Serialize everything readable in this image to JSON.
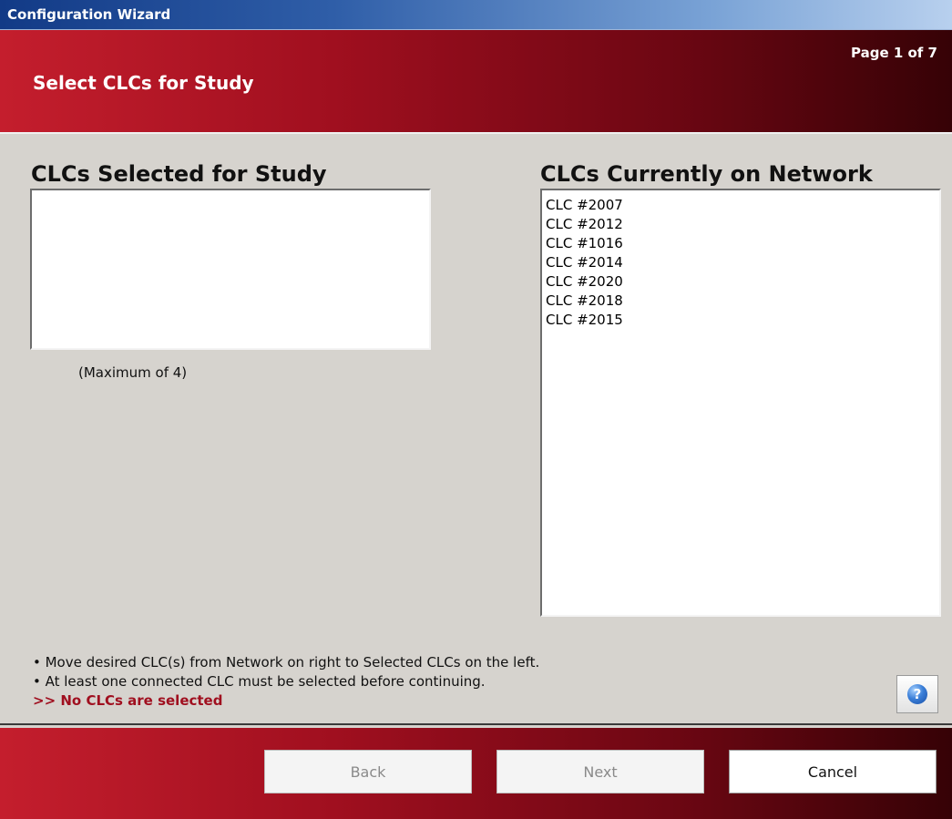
{
  "window": {
    "title": "Configuration Wizard"
  },
  "header": {
    "title": "Select CLCs for Study",
    "page_indicator": "Page 1 of 7"
  },
  "selected_panel": {
    "title": "CLCs Selected for Study",
    "items": [],
    "note": "(Maximum of 4)"
  },
  "network_panel": {
    "title": "CLCs Currently on Network",
    "items": [
      "CLC #2007",
      "CLC #2012",
      "CLC #1016",
      "CLC #2014",
      "CLC #2020",
      "CLC #2018",
      "CLC #2015"
    ]
  },
  "instructions": {
    "line1": "• Move desired CLC(s) from Network on right to Selected CLCs on the left.",
    "line2": "• At least one connected CLC must be selected before continuing.",
    "status": ">> No CLCs are selected"
  },
  "buttons": {
    "back": "Back",
    "next": "Next",
    "cancel": "Cancel"
  },
  "icons": {
    "help": "help-icon"
  },
  "colors": {
    "header_start": "#c41e2d",
    "header_end": "#360206",
    "titlebar": "#123a86",
    "status_text": "#a00f1f",
    "background": "#d6d3ce"
  }
}
